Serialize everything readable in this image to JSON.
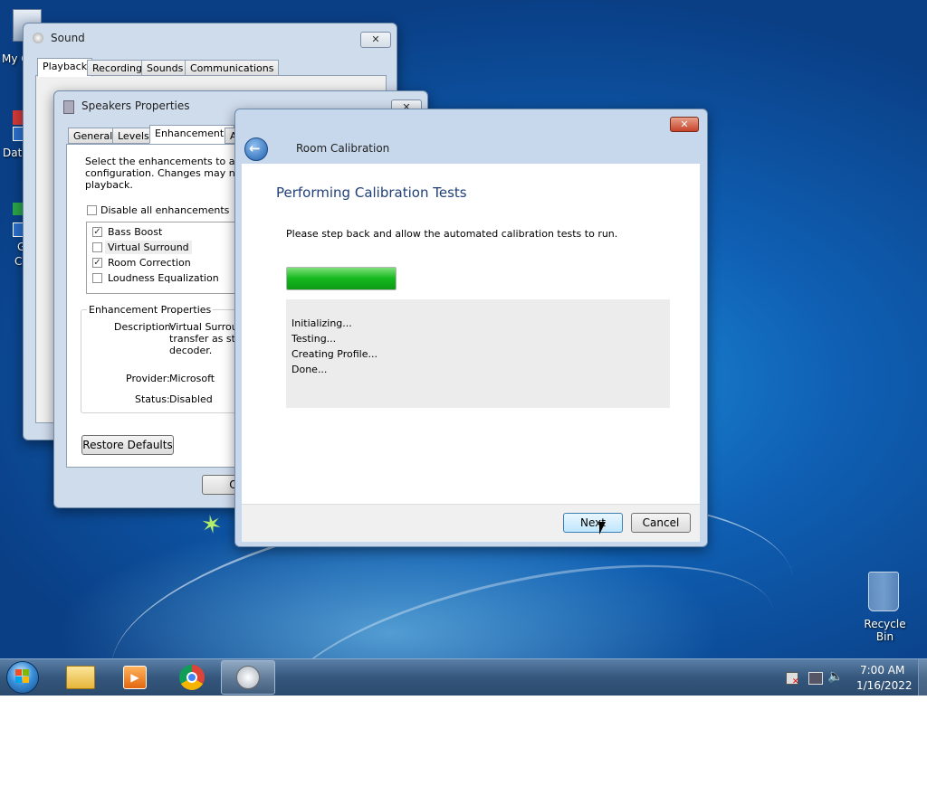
{
  "desktop": {
    "icons": [
      {
        "label": "My C"
      },
      {
        "label": "Data"
      },
      {
        "label": "G"
      },
      {
        "label": "C"
      }
    ],
    "recycle_bin": {
      "label": "Recycle Bin"
    }
  },
  "sound_window": {
    "title": "Sound",
    "close": "✕",
    "tabs": [
      "Playback",
      "Recording",
      "Sounds",
      "Communications"
    ]
  },
  "speakers_window": {
    "title": "Speakers Properties",
    "close": "✕",
    "tabs": [
      "General",
      "Levels",
      "Enhancements",
      "A"
    ],
    "intro": [
      "Select the enhancements to apply",
      "configuration. Changes may not ta",
      "playback."
    ],
    "disable_all": "Disable all enhancements",
    "enhancements": [
      {
        "label": "Bass Boost",
        "checked": true
      },
      {
        "label": "Virtual Surround",
        "checked": false
      },
      {
        "label": "Room Correction",
        "checked": true
      },
      {
        "label": "Loudness Equalization",
        "checked": false
      }
    ],
    "props_group": "Enhancement Properties",
    "description_label": "Description:",
    "description_lines": [
      "Virtual Surroun",
      "transfer as ste",
      "decoder."
    ],
    "provider_label": "Provider:",
    "provider_value": "Microsoft",
    "status_label": "Status:",
    "status_value": "Disabled",
    "restore_button": "Restore Defaults",
    "ok_partial": "O"
  },
  "calibration": {
    "title": "Room Calibration",
    "close": "✕",
    "heading": "Performing Calibration Tests",
    "instruction": "Please step back and allow the automated calibration tests to run.",
    "progress": 1.0,
    "progress_color": "#22c22a",
    "log": [
      "Initializing...",
      "Testing...",
      "Creating Profile...",
      "Done..."
    ],
    "next_button": "Next",
    "cancel_button": "Cancel"
  },
  "taskbar": {
    "time": "7:00 AM",
    "date": "1/16/2022",
    "pinned": [
      "start-orb-icon",
      "file-explorer-icon",
      "media-player-icon",
      "chrome-icon",
      "sound-icon"
    ]
  }
}
